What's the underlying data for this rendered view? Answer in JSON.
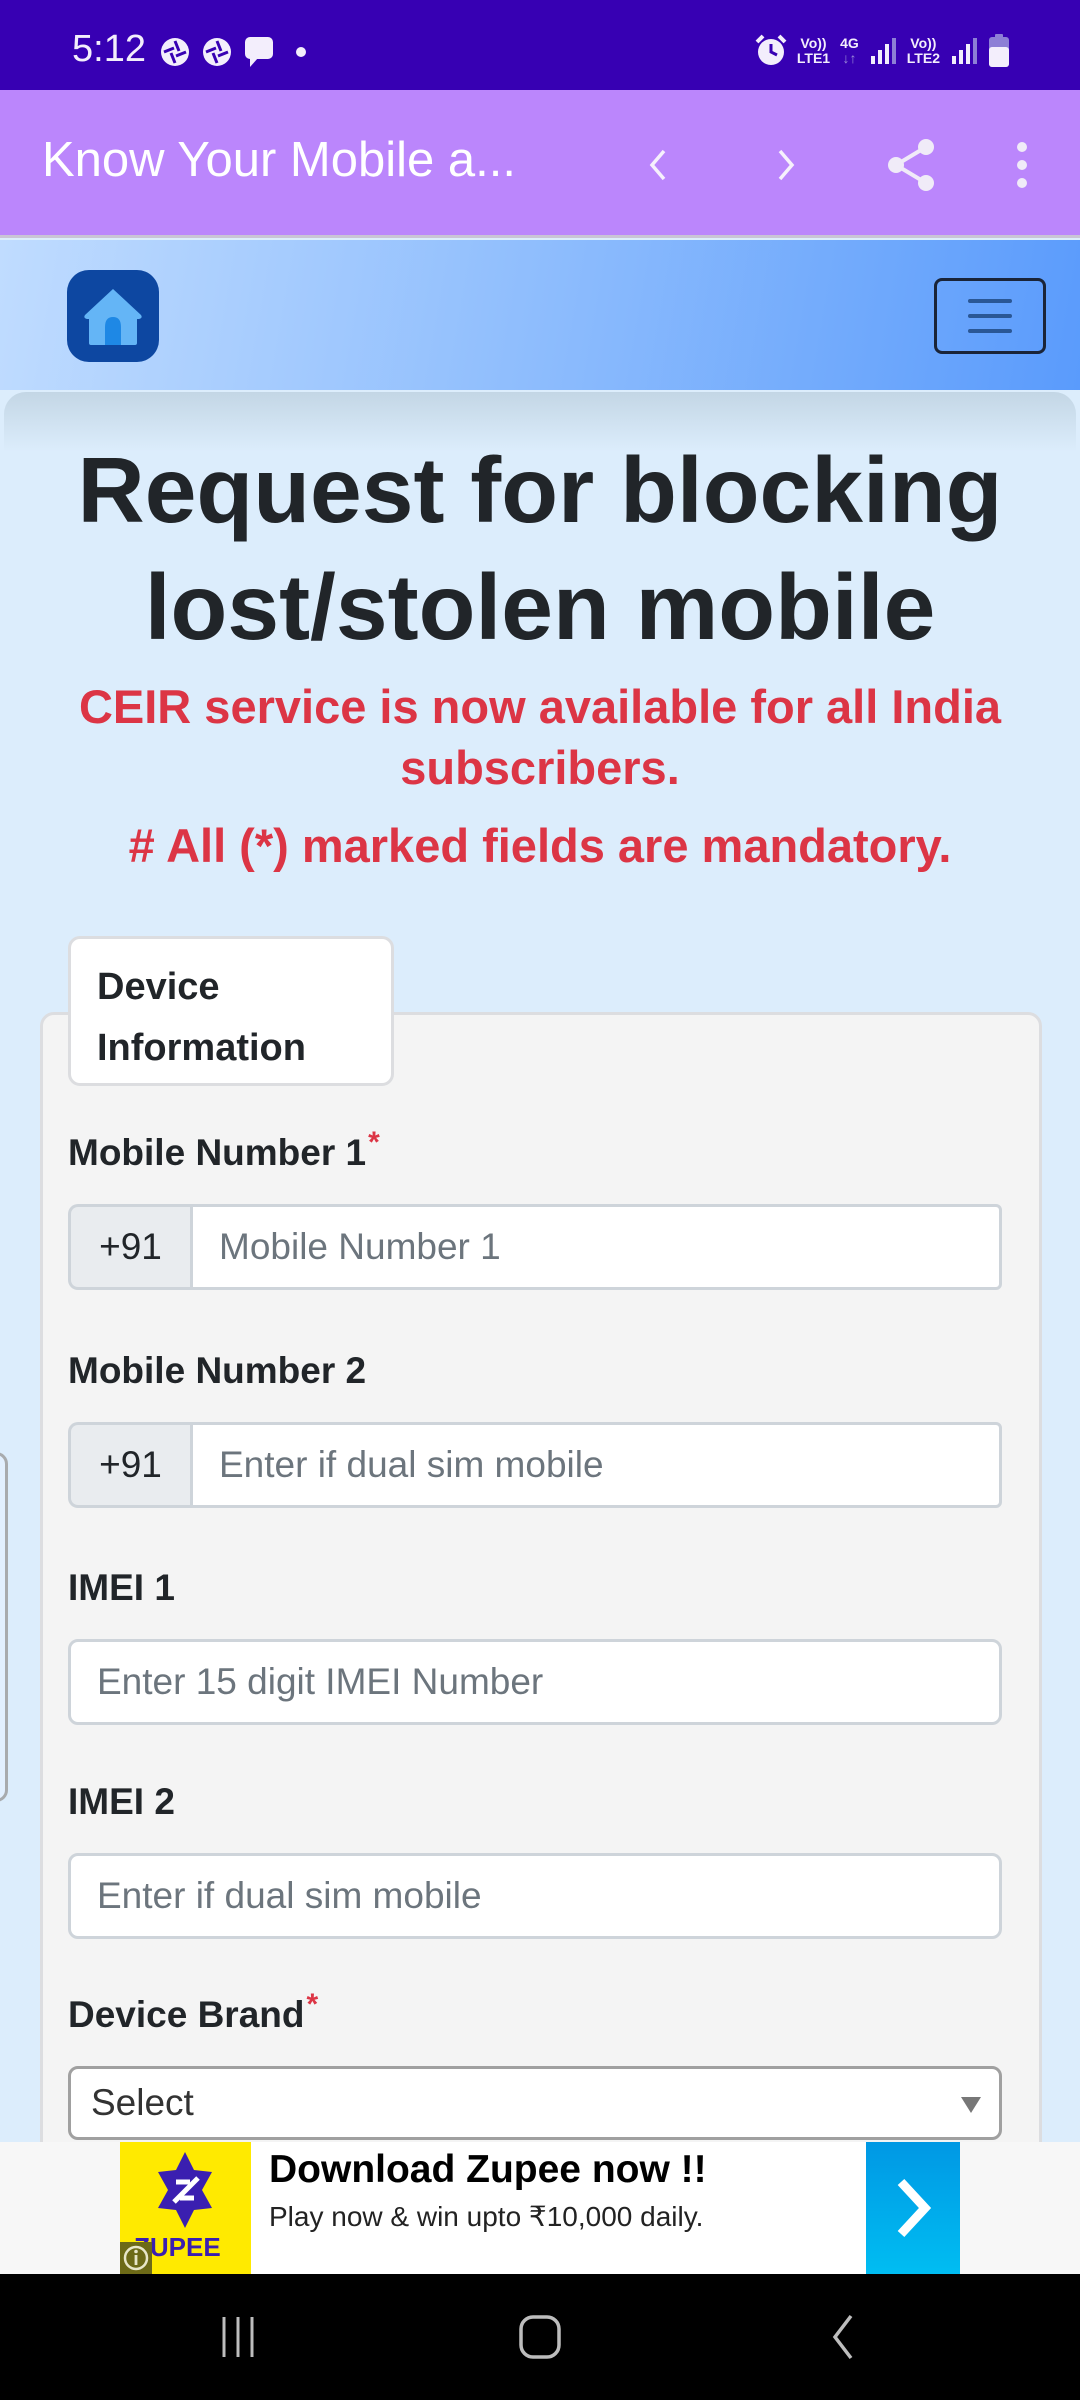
{
  "status_bar": {
    "time": "5:12",
    "left_icons": [
      "camera-aperture-icon",
      "camera-aperture-icon",
      "chat-bubble-icon",
      "dot-icon"
    ],
    "network": {
      "sim1_top": "Vo))",
      "sim1_bottom": "LTE1",
      "data_type": "4G",
      "sim2_top": "Vo))",
      "sim2_bottom": "LTE2"
    },
    "right_icons": [
      "alarm-icon",
      "signal-icon",
      "signal-icon",
      "battery-icon"
    ]
  },
  "app_bar": {
    "title": "Know Your Mobile a...",
    "actions": [
      "back-arrow",
      "forward-arrow",
      "share",
      "more-options"
    ]
  },
  "nav_header": {
    "logo": "home-icon",
    "menu": "hamburger-menu"
  },
  "page": {
    "title": "Request for blocking lost/stolen mobile",
    "notice": "CEIR service is now available for all India subscribers.",
    "mandatory_note": "# All (*) marked fields are mandatory."
  },
  "form": {
    "tab_label": "Device Information",
    "fields": [
      {
        "label": "Mobile Number 1",
        "required": "*",
        "prefix": "+91",
        "placeholder": "Mobile Number 1",
        "value": ""
      },
      {
        "label": "Mobile Number 2",
        "prefix": "+91",
        "placeholder": "Enter if dual sim mobile",
        "value": ""
      },
      {
        "label": "IMEI 1",
        "placeholder": "Enter 15 digit IMEI Number",
        "value": ""
      },
      {
        "label": "IMEI 2",
        "placeholder": "Enter if dual sim mobile",
        "value": ""
      },
      {
        "label": "Device Brand",
        "required": "*",
        "selected": "Select"
      }
    ]
  },
  "ad": {
    "brand": "ZUPEE",
    "title": "Download Zupee now !!",
    "subtitle": "Play now & win upto ₹10,000 daily.",
    "info_icon": "i"
  },
  "colors": {
    "status_bar": "#3700b3",
    "app_bar": "#bb86fc",
    "danger": "#dc3545",
    "text": "#212529",
    "logo_bg": "#0d47a1",
    "ad_yellow": "#ffea00",
    "ad_blue": "#00aeef"
  }
}
